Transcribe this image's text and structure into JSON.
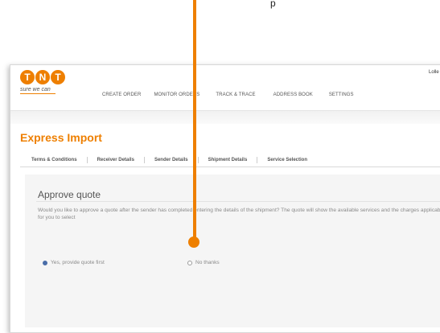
{
  "overlay": {
    "hint_text": "p",
    "colors": {
      "pointer": "#ee7f00"
    }
  },
  "brand": {
    "logo_letters": [
      "T",
      "N",
      "T"
    ],
    "tagline": "sure we can",
    "colors": {
      "primary": "#ee7f00"
    }
  },
  "header": {
    "user_link": "Lolle",
    "nav": [
      {
        "label": "CREATE ORDER"
      },
      {
        "label": "MONITOR ORDERS"
      },
      {
        "label": "TRACK & TRACE"
      },
      {
        "label": "ADDRESS BOOK"
      },
      {
        "label": "SETTINGS"
      }
    ]
  },
  "page": {
    "title": "Express Import",
    "tabs": [
      {
        "label": "Terms & Conditions"
      },
      {
        "label": "Receiver Details"
      },
      {
        "label": "Sender Details"
      },
      {
        "label": "Shipment Details"
      },
      {
        "label": "Service Selection"
      }
    ]
  },
  "panel": {
    "title": "Approve quote",
    "description": "Would you like to approve a quote after the sender has completed entering the details of the shipment? The quote will show the available services and the charges applicable for you to select",
    "options": [
      {
        "label": "Yes, provide quote first",
        "checked": true
      },
      {
        "label": "No thanks",
        "checked": false
      }
    ],
    "colors": {
      "radio_selected": "#4a6da8"
    }
  }
}
